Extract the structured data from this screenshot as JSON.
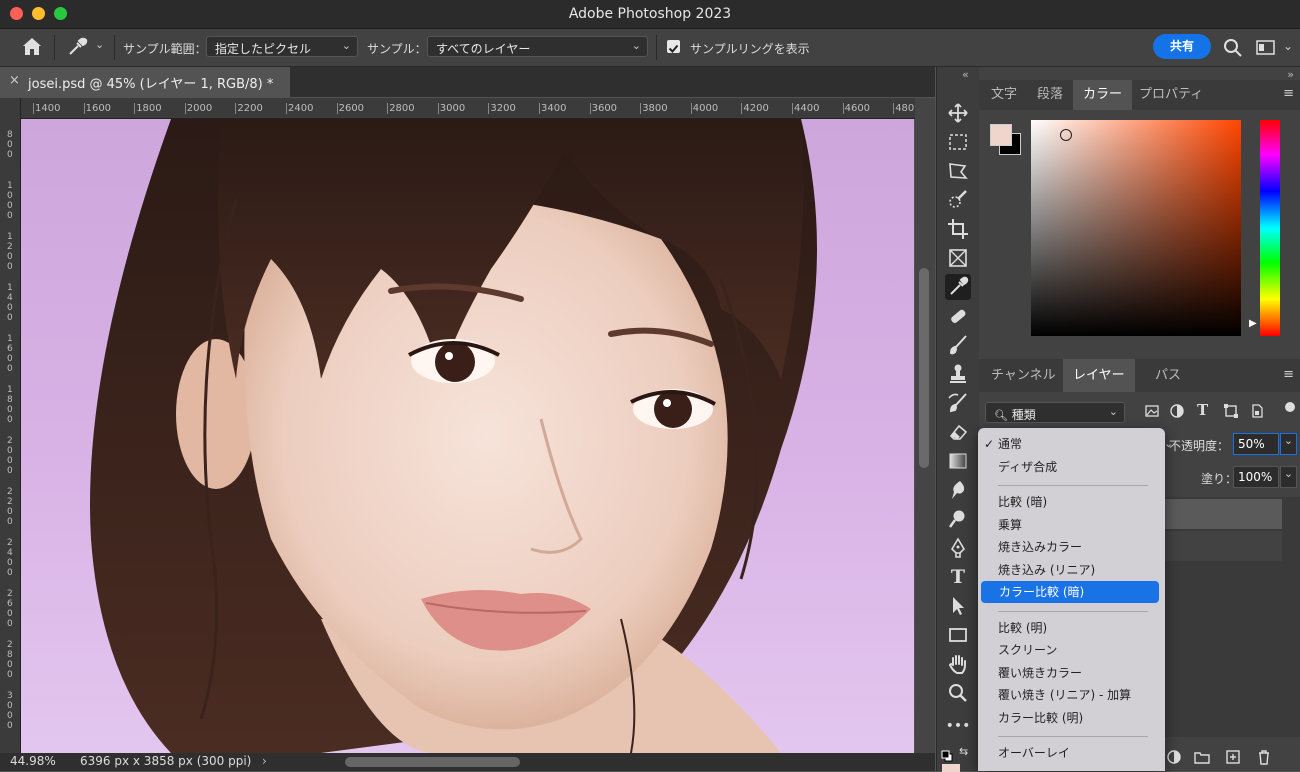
{
  "window": {
    "title": "Adobe Photoshop 2023"
  },
  "options_bar": {
    "sample_size_label": "サンプル範囲：",
    "sample_size_value": "指定したピクセル",
    "sample_label": "サンプル：",
    "sample_value": "すべてのレイヤー",
    "show_ring_label": "サンプルリングを表示",
    "show_ring_checked": true,
    "share_label": "共有"
  },
  "document": {
    "tab_title": "josei.psd @ 45% (レイヤー 1, RGB/8) *",
    "ruler_h": [
      "1400",
      "1600",
      "1800",
      "2000",
      "2200",
      "2400",
      "2600",
      "2800",
      "3000",
      "3200",
      "3400",
      "3600",
      "3800",
      "4000",
      "4200",
      "4400",
      "4600",
      "480"
    ],
    "ruler_v": [
      "800",
      "1000",
      "1200",
      "1400",
      "1600",
      "1800",
      "2000",
      "2200",
      "2400",
      "2600",
      "2800",
      "3000"
    ]
  },
  "status": {
    "zoom": "44.98%",
    "doc_info": "6396 px x 3858 px (300 ppi)"
  },
  "color_panel": {
    "tabs": [
      "文字",
      "段落",
      "カラー",
      "プロパティ"
    ],
    "active_tab": "カラー",
    "foreground": "#f0d5cc",
    "background": "#000000"
  },
  "layers_panel": {
    "tabs": [
      "チャンネル",
      "レイヤー",
      "パス"
    ],
    "active_tab": "レイヤー",
    "filter_value": "種類",
    "opacity_label": "不透明度：",
    "opacity_value": "50%",
    "fill_label": "塗り：",
    "fill_value": "100%"
  },
  "blend_menu": {
    "groups": [
      [
        "通常",
        "ディザ合成"
      ],
      [
        "比較 (暗)",
        "乗算",
        "焼き込みカラー",
        "焼き込み (リニア)",
        "カラー比較 (暗)"
      ],
      [
        "比較 (明)",
        "スクリーン",
        "覆い焼きカラー",
        "覆い焼き (リニア) - 加算",
        "カラー比較 (明)"
      ],
      [
        "オーバーレイ"
      ]
    ],
    "checked": "通常",
    "highlighted": "カラー比較 (暗)"
  },
  "colors": {
    "accent": "#1473e6",
    "highlight": "#1a73e6",
    "canvas_bg": "#d4b0e1"
  }
}
